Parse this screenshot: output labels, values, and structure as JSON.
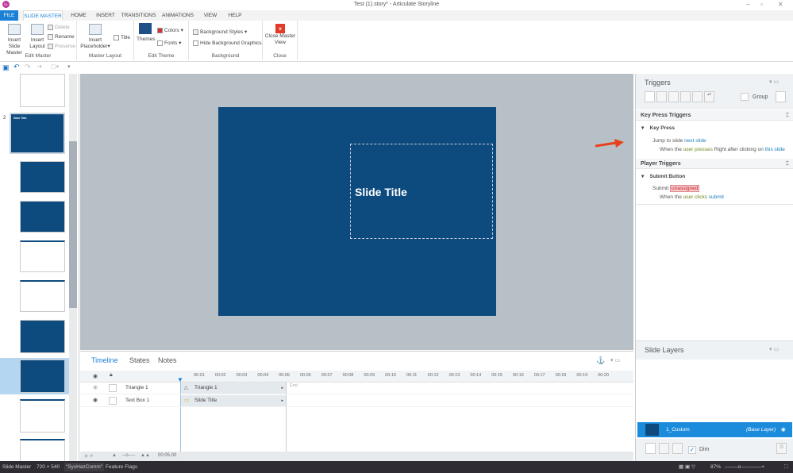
{
  "window": {
    "title": "Test (1).story* - Articulate Storyline",
    "logo": "SL"
  },
  "tabs": [
    "FILE",
    "SLIDE MASTER",
    "HOME",
    "INSERT",
    "TRANSITIONS",
    "ANIMATIONS",
    "VIEW",
    "HELP"
  ],
  "ribbon": {
    "edit_master": {
      "label": "Edit Master",
      "insert_slide_master": "Insert Slide Master",
      "insert_layout": "Insert Layout",
      "delete": "Delete",
      "rename": "Rename",
      "preserve": "Preserve"
    },
    "master_layout": {
      "label": "Master Layout",
      "insert_placeholder": "Insert Placeholder",
      "title": "Title"
    },
    "edit_theme": {
      "label": "Edit Theme",
      "themes": "Themes",
      "colors": "Colors",
      "fonts": "Fonts"
    },
    "background": {
      "label": "Background",
      "background_styles": "Background Styles",
      "hide_background_graphics": "Hide Background Graphics"
    },
    "close": {
      "label": "Close",
      "close_master_view": "Close Master View"
    }
  },
  "thumbnails": {
    "slide_number": "2",
    "thumb_title": "Slide Title"
  },
  "canvas": {
    "slide_title": "Slide Title",
    "slide_color": "#0d4a7e"
  },
  "timeline": {
    "tabs": [
      "Timeline",
      "States",
      "Notes"
    ],
    "ticks": [
      "00:01",
      "00:02",
      "00:03",
      "00:04",
      "00:05",
      "00:06",
      "00:07",
      "00:08",
      "00:09",
      "00:10",
      "00:11",
      "00:12",
      "00:13",
      "00:14",
      "00:15",
      "00:16",
      "00:17",
      "00:18",
      "00:19",
      "00:20"
    ],
    "end_label": "End",
    "rows": [
      {
        "name": "Triangle 1",
        "bar": "Triangle 1"
      },
      {
        "name": "Text Box 1",
        "bar": "Slide Title"
      }
    ],
    "duration": "00:05.00"
  },
  "triggers": {
    "title": "Triggers",
    "group": "Group",
    "sections": [
      {
        "title": "Key Press Triggers",
        "group": "Key Press",
        "action": "Jump to slide",
        "target": "next slide",
        "cond_pre": "When the",
        "cond_event": "user presses",
        "cond_mid": "Right after clicking on",
        "cond_obj": "this slide"
      },
      {
        "title": "Player Triggers",
        "group": "Submit Button",
        "action": "Submit",
        "target": "unassigned",
        "cond_pre": "When the",
        "cond_event": "user clicks",
        "cond_obj": "submit"
      }
    ]
  },
  "layers": {
    "title": "Slide Layers",
    "layer_name": "1_Custom",
    "base": "(Base Layer)",
    "dim": "Dim"
  },
  "status": {
    "mode": "Slide Master",
    "size": "720 × 540",
    "theme": "\"SysHazComm\"",
    "flags": "Feature Flags",
    "zoom": "87%"
  },
  "colors": {
    "accent": "#1b80d6",
    "arrow": "#e8401c"
  }
}
